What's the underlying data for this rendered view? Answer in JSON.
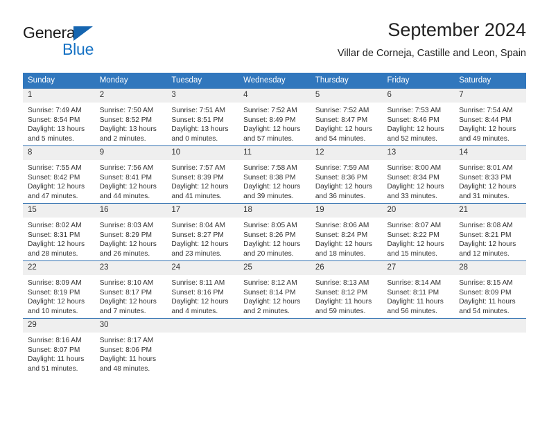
{
  "brand": {
    "name_part1": "General",
    "name_part2": "Blue",
    "triangle_color": "#1565b0",
    "blue_color": "#1672c4"
  },
  "header": {
    "title": "September 2024",
    "subtitle": "Villar de Corneja, Castille and Leon, Spain"
  },
  "theme": {
    "header_bg": "#3177bd",
    "daynum_bg": "#efefef",
    "row_border": "#2f6fb0"
  },
  "calendar": {
    "weekday_headers": [
      "Sunday",
      "Monday",
      "Tuesday",
      "Wednesday",
      "Thursday",
      "Friday",
      "Saturday"
    ],
    "weeks": [
      [
        {
          "day": "1",
          "sunrise": "Sunrise: 7:49 AM",
          "sunset": "Sunset: 8:54 PM",
          "daylight": "Daylight: 13 hours and 5 minutes."
        },
        {
          "day": "2",
          "sunrise": "Sunrise: 7:50 AM",
          "sunset": "Sunset: 8:52 PM",
          "daylight": "Daylight: 13 hours and 2 minutes."
        },
        {
          "day": "3",
          "sunrise": "Sunrise: 7:51 AM",
          "sunset": "Sunset: 8:51 PM",
          "daylight": "Daylight: 13 hours and 0 minutes."
        },
        {
          "day": "4",
          "sunrise": "Sunrise: 7:52 AM",
          "sunset": "Sunset: 8:49 PM",
          "daylight": "Daylight: 12 hours and 57 minutes."
        },
        {
          "day": "5",
          "sunrise": "Sunrise: 7:52 AM",
          "sunset": "Sunset: 8:47 PM",
          "daylight": "Daylight: 12 hours and 54 minutes."
        },
        {
          "day": "6",
          "sunrise": "Sunrise: 7:53 AM",
          "sunset": "Sunset: 8:46 PM",
          "daylight": "Daylight: 12 hours and 52 minutes."
        },
        {
          "day": "7",
          "sunrise": "Sunrise: 7:54 AM",
          "sunset": "Sunset: 8:44 PM",
          "daylight": "Daylight: 12 hours and 49 minutes."
        }
      ],
      [
        {
          "day": "8",
          "sunrise": "Sunrise: 7:55 AM",
          "sunset": "Sunset: 8:42 PM",
          "daylight": "Daylight: 12 hours and 47 minutes."
        },
        {
          "day": "9",
          "sunrise": "Sunrise: 7:56 AM",
          "sunset": "Sunset: 8:41 PM",
          "daylight": "Daylight: 12 hours and 44 minutes."
        },
        {
          "day": "10",
          "sunrise": "Sunrise: 7:57 AM",
          "sunset": "Sunset: 8:39 PM",
          "daylight": "Daylight: 12 hours and 41 minutes."
        },
        {
          "day": "11",
          "sunrise": "Sunrise: 7:58 AM",
          "sunset": "Sunset: 8:38 PM",
          "daylight": "Daylight: 12 hours and 39 minutes."
        },
        {
          "day": "12",
          "sunrise": "Sunrise: 7:59 AM",
          "sunset": "Sunset: 8:36 PM",
          "daylight": "Daylight: 12 hours and 36 minutes."
        },
        {
          "day": "13",
          "sunrise": "Sunrise: 8:00 AM",
          "sunset": "Sunset: 8:34 PM",
          "daylight": "Daylight: 12 hours and 33 minutes."
        },
        {
          "day": "14",
          "sunrise": "Sunrise: 8:01 AM",
          "sunset": "Sunset: 8:33 PM",
          "daylight": "Daylight: 12 hours and 31 minutes."
        }
      ],
      [
        {
          "day": "15",
          "sunrise": "Sunrise: 8:02 AM",
          "sunset": "Sunset: 8:31 PM",
          "daylight": "Daylight: 12 hours and 28 minutes."
        },
        {
          "day": "16",
          "sunrise": "Sunrise: 8:03 AM",
          "sunset": "Sunset: 8:29 PM",
          "daylight": "Daylight: 12 hours and 26 minutes."
        },
        {
          "day": "17",
          "sunrise": "Sunrise: 8:04 AM",
          "sunset": "Sunset: 8:27 PM",
          "daylight": "Daylight: 12 hours and 23 minutes."
        },
        {
          "day": "18",
          "sunrise": "Sunrise: 8:05 AM",
          "sunset": "Sunset: 8:26 PM",
          "daylight": "Daylight: 12 hours and 20 minutes."
        },
        {
          "day": "19",
          "sunrise": "Sunrise: 8:06 AM",
          "sunset": "Sunset: 8:24 PM",
          "daylight": "Daylight: 12 hours and 18 minutes."
        },
        {
          "day": "20",
          "sunrise": "Sunrise: 8:07 AM",
          "sunset": "Sunset: 8:22 PM",
          "daylight": "Daylight: 12 hours and 15 minutes."
        },
        {
          "day": "21",
          "sunrise": "Sunrise: 8:08 AM",
          "sunset": "Sunset: 8:21 PM",
          "daylight": "Daylight: 12 hours and 12 minutes."
        }
      ],
      [
        {
          "day": "22",
          "sunrise": "Sunrise: 8:09 AM",
          "sunset": "Sunset: 8:19 PM",
          "daylight": "Daylight: 12 hours and 10 minutes."
        },
        {
          "day": "23",
          "sunrise": "Sunrise: 8:10 AM",
          "sunset": "Sunset: 8:17 PM",
          "daylight": "Daylight: 12 hours and 7 minutes."
        },
        {
          "day": "24",
          "sunrise": "Sunrise: 8:11 AM",
          "sunset": "Sunset: 8:16 PM",
          "daylight": "Daylight: 12 hours and 4 minutes."
        },
        {
          "day": "25",
          "sunrise": "Sunrise: 8:12 AM",
          "sunset": "Sunset: 8:14 PM",
          "daylight": "Daylight: 12 hours and 2 minutes."
        },
        {
          "day": "26",
          "sunrise": "Sunrise: 8:13 AM",
          "sunset": "Sunset: 8:12 PM",
          "daylight": "Daylight: 11 hours and 59 minutes."
        },
        {
          "day": "27",
          "sunrise": "Sunrise: 8:14 AM",
          "sunset": "Sunset: 8:11 PM",
          "daylight": "Daylight: 11 hours and 56 minutes."
        },
        {
          "day": "28",
          "sunrise": "Sunrise: 8:15 AM",
          "sunset": "Sunset: 8:09 PM",
          "daylight": "Daylight: 11 hours and 54 minutes."
        }
      ],
      [
        {
          "day": "29",
          "sunrise": "Sunrise: 8:16 AM",
          "sunset": "Sunset: 8:07 PM",
          "daylight": "Daylight: 11 hours and 51 minutes."
        },
        {
          "day": "30",
          "sunrise": "Sunrise: 8:17 AM",
          "sunset": "Sunset: 8:06 PM",
          "daylight": "Daylight: 11 hours and 48 minutes."
        },
        {
          "day": "",
          "sunrise": "",
          "sunset": "",
          "daylight": ""
        },
        {
          "day": "",
          "sunrise": "",
          "sunset": "",
          "daylight": ""
        },
        {
          "day": "",
          "sunrise": "",
          "sunset": "",
          "daylight": ""
        },
        {
          "day": "",
          "sunrise": "",
          "sunset": "",
          "daylight": ""
        },
        {
          "day": "",
          "sunrise": "",
          "sunset": "",
          "daylight": ""
        }
      ]
    ]
  }
}
